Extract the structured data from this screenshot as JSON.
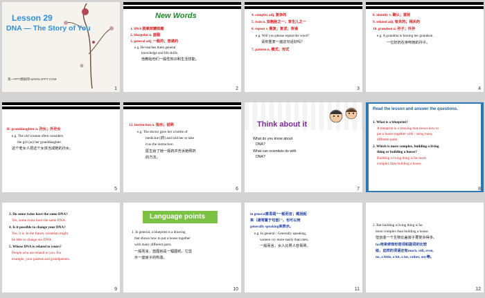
{
  "slides": [
    {
      "num": "1",
      "title": "Lesson 29",
      "subtitle": "DNA — The Story of You",
      "footer": "第一PPT模板网-WWW.1PPT.COM"
    },
    {
      "num": "2",
      "title": "New Words",
      "lines": [
        "1. DNA    脱氧核糖核酸",
        "2. blueprint  n.  蓝图",
        "3. general  adj.  一般的；普通的",
        "e.g. He teaches them  general",
        "knowledge  and  life skills.",
        "他教给他们一般性知识和生活技能。"
      ]
    },
    {
      "num": "3",
      "lines": [
        "4. complex    adj.  复杂的",
        "5. twin  n.  双胞胎之一；孪生儿之一",
        "6. repeat  v.  重复；复述；背诵",
        "e.g. Will you please  repeat  the word?",
        "请你重复一遍这句话好吗？",
        "7. pattern    n.  模式；形式"
      ]
    },
    {
      "num": "4",
      "lines": [
        "8. identify   v.   确认；鉴别",
        "9. related  adj.  有关的；相关的",
        "10. grandson   n.  孙子；外孙",
        "e.g. A grandma  is kissing her grandson.",
        "一位奶奶在亲吻她的孙子。"
      ]
    },
    {
      "num": "5",
      "lines": [
        "11. granddaughter   n.   孙女；外孙女",
        "e.g. The old woman  often considers",
        "the girl (as) her  granddaughter.",
        "这个老女人把这个女孩当成她的孙女。"
      ]
    },
    {
      "num": "6",
      "lines": [
        "12. instruction   n.   指示；说明",
        "e.g. The doctor gave her a bottle of",
        "medicine  (药) and told her to take",
        "it as the  instruction.",
        "医生给了她一瓶药并告诉她照药",
        "的方法。"
      ]
    },
    {
      "num": "7",
      "title": "Think about it",
      "lines": [
        "What do you know about",
        "DNA?",
        "What can scientists do with",
        "DNA?"
      ]
    },
    {
      "num": "8",
      "title": "Read the lesson and answer the questions.",
      "lines": [
        "1. What is a blueprint?",
        "A blueprint  is a drawing  that shows how to",
        "put a house together with / using many",
        "different parts.",
        "2. Which is more complex, building a living",
        "thing or building a house?",
        "Building a living thing is far more",
        "complex  than  building  a house."
      ]
    },
    {
      "num": "9",
      "lines": [
        "3. Do some twins have the same DNA?",
        "Yes, some twins have  the same DNA.",
        "4. Is it possible to change your DNA?",
        "Yes, it is. In the future,  scientists might",
        "be able to change our DNA.",
        "5. Whose DNA is related to yours?",
        "People who are related to you. For",
        "example, your parents and grandparents."
      ]
    },
    {
      "num": "10",
      "title": "Language points",
      "lines": [
        "1. In general,  a blueprint  is a drawing",
        "that  shows how  to put  a house together",
        "with  many  different  parts.",
        "一般而言，蓝图就是一幅图纸，它显",
        "示一座房子的构造。"
      ]
    },
    {
      "num": "11",
      "lines": [
        "in general意思是“一般而言；概括起",
        "来（通常置于句首）”，也可以用",
        "generally speaking来表示。",
        "e.g.  In general / Generally  speaking,",
        "women  cry more easily than men.",
        "一般而言，女人比男人容易哭。"
      ]
    },
    {
      "num": "12",
      "lines": [
        "2. But building  a living thing is far",
        "more complex  than building  a house.",
        "但创造一个生物比盖房子要复杂得多。",
        "far用来修饰形容词和副词的比较",
        "级，这样的词语还有much, still, even,",
        "no, a little, a bit, a lot, rather, any等。"
      ]
    }
  ]
}
